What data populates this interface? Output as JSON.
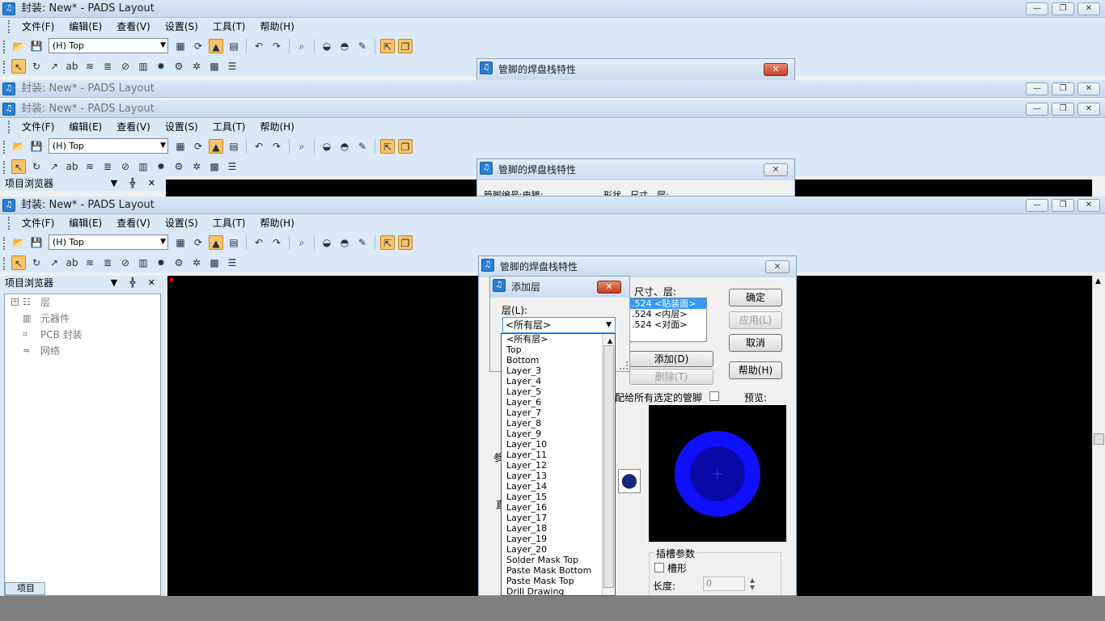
{
  "app": {
    "title": "封装: New* - PADS Layout",
    "window_controls": [
      "—",
      "❐",
      "✕"
    ]
  },
  "menu": [
    "文件(F)",
    "编辑(E)",
    "查看(V)",
    "设置(S)",
    "工具(T)",
    "帮助(H)"
  ],
  "toolbar": {
    "layer_value": "(H) Top"
  },
  "browser": {
    "title": "项目浏览器",
    "header_controls": "▼ ╬ ✕",
    "items": [
      {
        "label": "层",
        "icon": "layers-icon"
      },
      {
        "label": "元器件",
        "icon": "component-icon"
      },
      {
        "label": "PCB 封装",
        "icon": "decal-icon"
      },
      {
        "label": "网络",
        "icon": "net-icon"
      }
    ],
    "bottom_tab": "项目"
  },
  "padstack_dialog": {
    "title": "管脚的焊盘栈特性",
    "ghost_row_text": "管脚编号:电镀:",
    "ghost_shape_text": "形状、尺寸、层:",
    "shape_label": "尺寸、层:",
    "shape_list": [
      ".524 <贴装面>",
      ".524 <内层>",
      ".524 <对面>"
    ],
    "ok": "确定",
    "apply": "应用(L)",
    "cancel": "取消",
    "help": "帮助(H)",
    "add": "添加(D)",
    "delete": "删除(T)",
    "assign_all": "配给所有选定的管脚",
    "preview": "预览:",
    "frag_param": "参",
    "frag_dir": "直",
    "slot_group": "插槽参数",
    "slot_check": "槽形",
    "length_label": "长度:",
    "length_value": "0",
    "pad_fill_color": "#1010ff",
    "pad_hole_color": "#0a0aa8"
  },
  "add_layer_dialog": {
    "title": "添加层",
    "layer_label": "层(L):",
    "selected": "<所有层>",
    "options": [
      "<所有层>",
      "Top",
      "Bottom",
      "Layer_3",
      "Layer_4",
      "Layer_5",
      "Layer_6",
      "Layer_7",
      "Layer_8",
      "Layer_9",
      "Layer_10",
      "Layer_11",
      "Layer_12",
      "Layer_13",
      "Layer_14",
      "Layer_15",
      "Layer_16",
      "Layer_17",
      "Layer_18",
      "Layer_19",
      "Layer_20",
      "Solder Mask Top",
      "Paste Mask Bottom",
      "Paste Mask Top",
      "Drill Drawing"
    ]
  },
  "colors": {
    "canvas": "#000000",
    "chrome": "#dbe8f6",
    "selection": "#3399ff"
  }
}
